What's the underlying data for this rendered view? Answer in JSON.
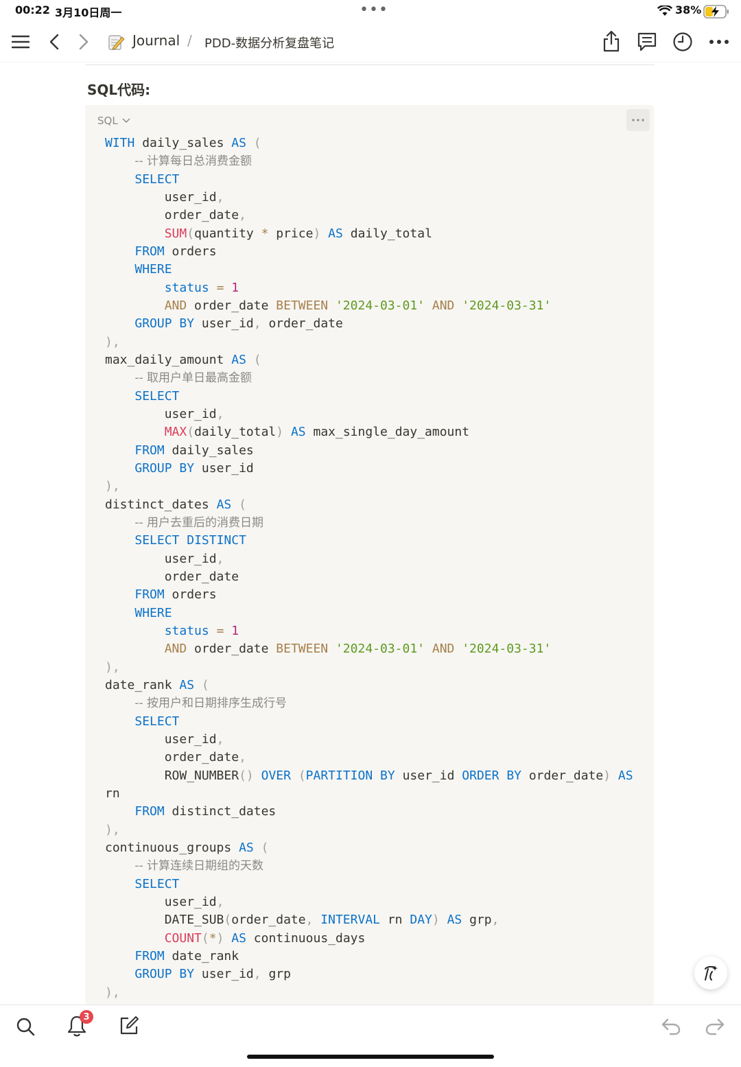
{
  "status_bar": {
    "time": "00:22",
    "date": "3月10日周一",
    "battery_percent": "38%",
    "battery_level": 0.38,
    "charging": true
  },
  "breadcrumb": {
    "workspace": "Journal",
    "separator": "/",
    "page": "PDD-数据分析复盘笔记"
  },
  "content": {
    "heading": "SQL代码:",
    "code_language": "SQL",
    "code_lines": [
      [
        [
          "WITH",
          "kw"
        ],
        [
          " daily_sales ",
          ""
        ],
        [
          "AS",
          "kw"
        ],
        [
          " (",
          "pn"
        ]
      ],
      [
        [
          "    ",
          ""
        ],
        [
          "-- 计算每日总消费金额",
          "cm"
        ]
      ],
      [
        [
          "    ",
          ""
        ],
        [
          "SELECT",
          "kw"
        ]
      ],
      [
        [
          "        user_id",
          ""
        ],
        [
          ",",
          "pn"
        ]
      ],
      [
        [
          "        order_date",
          ""
        ],
        [
          ",",
          "pn"
        ]
      ],
      [
        [
          "        ",
          ""
        ],
        [
          "SUM",
          "fn"
        ],
        [
          "(",
          "pn"
        ],
        [
          "quantity ",
          ""
        ],
        [
          "*",
          "op"
        ],
        [
          " price",
          ""
        ],
        [
          ")",
          "pn"
        ],
        [
          " ",
          ""
        ],
        [
          "AS",
          "kw"
        ],
        [
          " daily_total",
          ""
        ]
      ],
      [
        [
          "    ",
          ""
        ],
        [
          "FROM",
          "kw"
        ],
        [
          " orders",
          ""
        ]
      ],
      [
        [
          "    ",
          ""
        ],
        [
          "WHERE",
          "kw"
        ]
      ],
      [
        [
          "        ",
          ""
        ],
        [
          "status",
          "kw"
        ],
        [
          " ",
          ""
        ],
        [
          "=",
          "op"
        ],
        [
          " ",
          ""
        ],
        [
          "1",
          "num"
        ]
      ],
      [
        [
          "        ",
          ""
        ],
        [
          "AND",
          "op"
        ],
        [
          " order_date ",
          ""
        ],
        [
          "BETWEEN",
          "op"
        ],
        [
          " ",
          ""
        ],
        [
          "'2024-03-01'",
          "str"
        ],
        [
          " ",
          ""
        ],
        [
          "AND",
          "op"
        ],
        [
          " ",
          ""
        ],
        [
          "'2024-03-31'",
          "str"
        ]
      ],
      [
        [
          "    ",
          ""
        ],
        [
          "GROUP",
          "kw"
        ],
        [
          " ",
          ""
        ],
        [
          "BY",
          "kw"
        ],
        [
          " user_id",
          ""
        ],
        [
          ",",
          "pn"
        ],
        [
          " order_date",
          ""
        ]
      ],
      [
        [
          "),",
          "pn"
        ]
      ],
      [
        [
          "max_daily_amount ",
          ""
        ],
        [
          "AS",
          "kw"
        ],
        [
          " (",
          "pn"
        ]
      ],
      [
        [
          "    ",
          ""
        ],
        [
          "-- 取用户单日最高金额",
          "cm"
        ]
      ],
      [
        [
          "    ",
          ""
        ],
        [
          "SELECT",
          "kw"
        ]
      ],
      [
        [
          "        user_id",
          ""
        ],
        [
          ",",
          "pn"
        ]
      ],
      [
        [
          "        ",
          ""
        ],
        [
          "MAX",
          "fn"
        ],
        [
          "(",
          "pn"
        ],
        [
          "daily_total",
          ""
        ],
        [
          ")",
          "pn"
        ],
        [
          " ",
          ""
        ],
        [
          "AS",
          "kw"
        ],
        [
          " max_single_day_amount",
          ""
        ]
      ],
      [
        [
          "    ",
          ""
        ],
        [
          "FROM",
          "kw"
        ],
        [
          " daily_sales",
          ""
        ]
      ],
      [
        [
          "    ",
          ""
        ],
        [
          "GROUP",
          "kw"
        ],
        [
          " ",
          ""
        ],
        [
          "BY",
          "kw"
        ],
        [
          " user_id",
          ""
        ]
      ],
      [
        [
          "),",
          "pn"
        ]
      ],
      [
        [
          "distinct_dates ",
          ""
        ],
        [
          "AS",
          "kw"
        ],
        [
          " (",
          "pn"
        ]
      ],
      [
        [
          "    ",
          ""
        ],
        [
          "-- 用户去重后的消费日期",
          "cm"
        ]
      ],
      [
        [
          "    ",
          ""
        ],
        [
          "SELECT",
          "kw"
        ],
        [
          " ",
          ""
        ],
        [
          "DISTINCT",
          "kw"
        ]
      ],
      [
        [
          "        user_id",
          ""
        ],
        [
          ",",
          "pn"
        ]
      ],
      [
        [
          "        order_date",
          ""
        ]
      ],
      [
        [
          "    ",
          ""
        ],
        [
          "FROM",
          "kw"
        ],
        [
          " orders",
          ""
        ]
      ],
      [
        [
          "    ",
          ""
        ],
        [
          "WHERE",
          "kw"
        ]
      ],
      [
        [
          "        ",
          ""
        ],
        [
          "status",
          "kw"
        ],
        [
          " ",
          ""
        ],
        [
          "=",
          "op"
        ],
        [
          " ",
          ""
        ],
        [
          "1",
          "num"
        ]
      ],
      [
        [
          "        ",
          ""
        ],
        [
          "AND",
          "op"
        ],
        [
          " order_date ",
          ""
        ],
        [
          "BETWEEN",
          "op"
        ],
        [
          " ",
          ""
        ],
        [
          "'2024-03-01'",
          "str"
        ],
        [
          " ",
          ""
        ],
        [
          "AND",
          "op"
        ],
        [
          " ",
          ""
        ],
        [
          "'2024-03-31'",
          "str"
        ]
      ],
      [
        [
          "),",
          "pn"
        ]
      ],
      [
        [
          "date_rank ",
          ""
        ],
        [
          "AS",
          "kw"
        ],
        [
          " (",
          "pn"
        ]
      ],
      [
        [
          "    ",
          ""
        ],
        [
          "-- 按用户和日期排序生成行号",
          "cm"
        ]
      ],
      [
        [
          "    ",
          ""
        ],
        [
          "SELECT",
          "kw"
        ]
      ],
      [
        [
          "        user_id",
          ""
        ],
        [
          ",",
          "pn"
        ]
      ],
      [
        [
          "        order_date",
          ""
        ],
        [
          ",",
          "pn"
        ]
      ],
      [
        [
          "        ROW_NUMBER",
          ""
        ],
        [
          "()",
          "pn"
        ],
        [
          " ",
          ""
        ],
        [
          "OVER",
          "kw"
        ],
        [
          " ",
          ""
        ],
        [
          "(",
          "pn"
        ],
        [
          "PARTITION",
          "kw"
        ],
        [
          " ",
          ""
        ],
        [
          "BY",
          "kw"
        ],
        [
          " user_id ",
          ""
        ],
        [
          "ORDER",
          "kw"
        ],
        [
          " ",
          ""
        ],
        [
          "BY",
          "kw"
        ],
        [
          " order_date",
          ""
        ],
        [
          ")",
          "pn"
        ],
        [
          " ",
          ""
        ],
        [
          "AS",
          "kw"
        ]
      ],
      [
        [
          "rn",
          ""
        ]
      ],
      [
        [
          "    ",
          ""
        ],
        [
          "FROM",
          "kw"
        ],
        [
          " distinct_dates",
          ""
        ]
      ],
      [
        [
          "),",
          "pn"
        ]
      ],
      [
        [
          "continuous_groups ",
          ""
        ],
        [
          "AS",
          "kw"
        ],
        [
          " (",
          "pn"
        ]
      ],
      [
        [
          "    ",
          ""
        ],
        [
          "-- 计算连续日期组的天数",
          "cm"
        ]
      ],
      [
        [
          "    ",
          ""
        ],
        [
          "SELECT",
          "kw"
        ]
      ],
      [
        [
          "        user_id",
          ""
        ],
        [
          ",",
          "pn"
        ]
      ],
      [
        [
          "        DATE_SUB",
          ""
        ],
        [
          "(",
          "pn"
        ],
        [
          "order_date",
          ""
        ],
        [
          ",",
          "pn"
        ],
        [
          " ",
          ""
        ],
        [
          "INTERVAL",
          "kw"
        ],
        [
          " rn ",
          ""
        ],
        [
          "DAY",
          "kw"
        ],
        [
          ")",
          "pn"
        ],
        [
          " ",
          ""
        ],
        [
          "AS",
          "kw"
        ],
        [
          " grp",
          ""
        ],
        [
          ",",
          "pn"
        ]
      ],
      [
        [
          "        ",
          ""
        ],
        [
          "COUNT",
          "fn"
        ],
        [
          "(",
          "pn"
        ],
        [
          "*",
          "op"
        ],
        [
          ")",
          "pn"
        ],
        [
          " ",
          ""
        ],
        [
          "AS",
          "kw"
        ],
        [
          " continuous_days",
          ""
        ]
      ],
      [
        [
          "    ",
          ""
        ],
        [
          "FROM",
          "kw"
        ],
        [
          " date_rank",
          ""
        ]
      ],
      [
        [
          "    ",
          ""
        ],
        [
          "GROUP",
          "kw"
        ],
        [
          " ",
          ""
        ],
        [
          "BY",
          "kw"
        ],
        [
          " user_id",
          ""
        ],
        [
          ",",
          "pn"
        ],
        [
          " grp",
          ""
        ]
      ],
      [
        [
          "),",
          "pn"
        ]
      ]
    ]
  },
  "bottom_bar": {
    "notification_count": "3"
  },
  "icons": {
    "menu": "menu-icon",
    "back": "chevron-left-icon",
    "forward": "chevron-right-icon",
    "share": "share-icon",
    "comments": "comment-icon",
    "history": "clock-icon",
    "more": "more-icon",
    "search": "search-icon",
    "notifications": "bell-icon",
    "new_page": "compose-icon",
    "undo": "undo-icon",
    "redo": "redo-icon",
    "ai": "ai-assistant-icon"
  },
  "colors": {
    "keyword": "#0c72c8",
    "function": "#dc3c5a",
    "operator": "#a6804a",
    "string": "#5f9a1e",
    "number": "#b2277a",
    "punctuation": "#a0a09b",
    "comment": "#8a8a87",
    "code_background": "#f7f6f3",
    "badge": "#e5484d"
  }
}
